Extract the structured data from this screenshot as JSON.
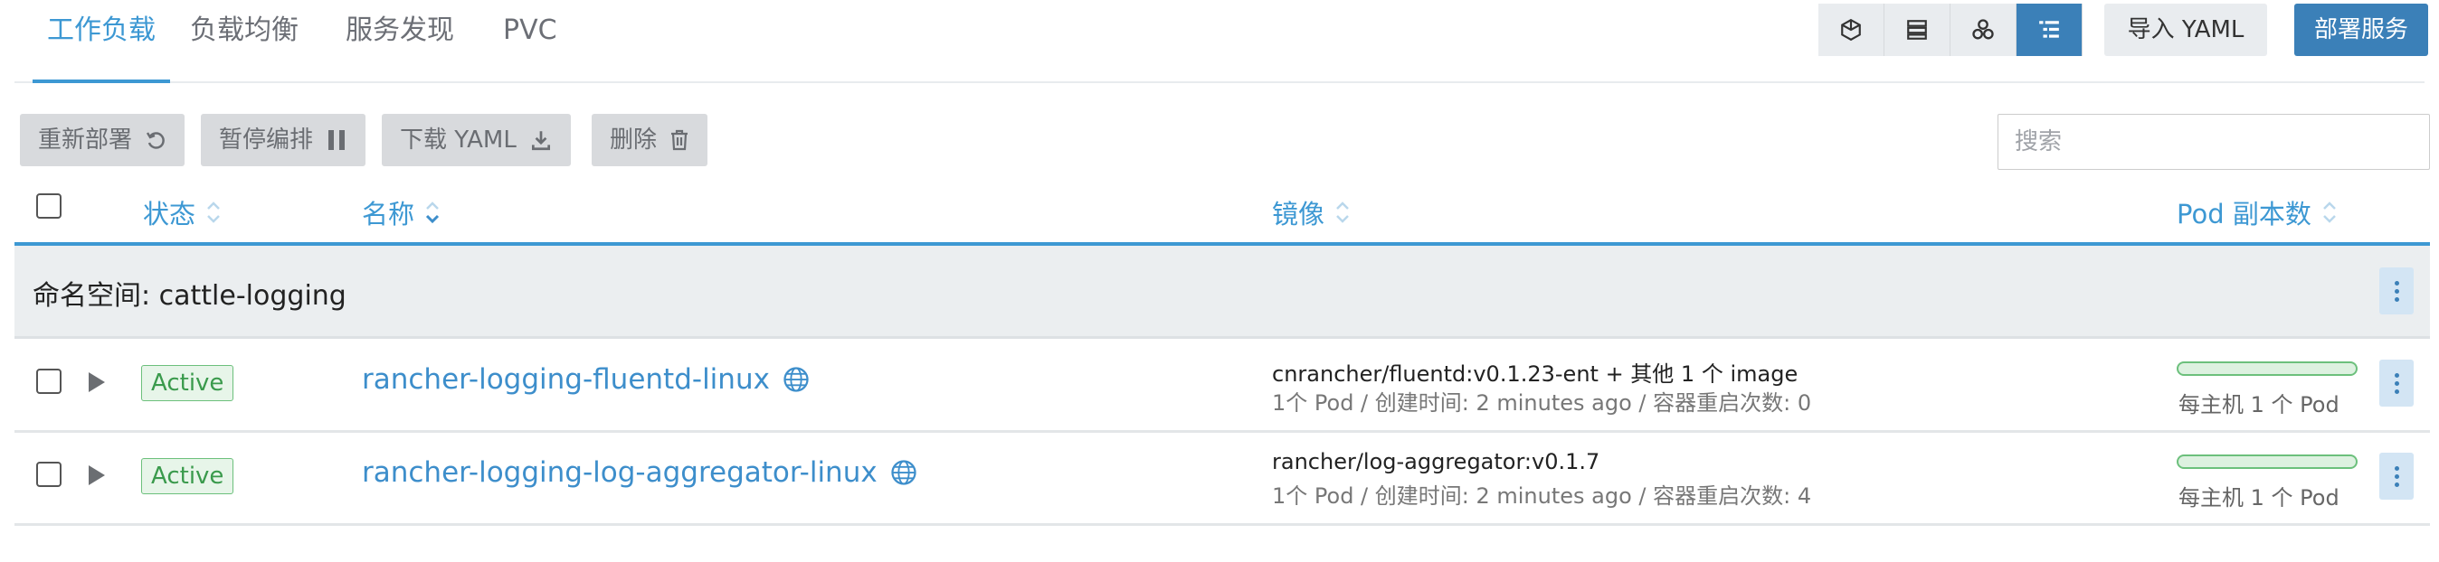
{
  "tabs": [
    {
      "label": "工作负载",
      "active": true
    },
    {
      "label": "负载均衡",
      "active": false
    },
    {
      "label": "服务发现",
      "active": false
    },
    {
      "label": "PVC",
      "active": false
    }
  ],
  "view_buttons": [
    {
      "icon": "cube-icon",
      "active": false
    },
    {
      "icon": "server-stack-icon",
      "active": false
    },
    {
      "icon": "cluster-icon",
      "active": false
    },
    {
      "icon": "list-tree-icon",
      "active": true
    }
  ],
  "header_actions": {
    "import_label": "导入 YAML",
    "deploy_label": "部署服务"
  },
  "actions": {
    "redeploy": "重新部署",
    "pause": "暂停编排",
    "download": "下载 YAML",
    "delete": "删除"
  },
  "search": {
    "placeholder": "搜索",
    "value": ""
  },
  "columns": {
    "state": "状态",
    "name": "名称",
    "image": "镜像",
    "pods": "Pod 副本数"
  },
  "namespace": {
    "label": "命名空间: cattle-logging"
  },
  "rows": [
    {
      "state": "Active",
      "name": "rancher-logging-fluentd-linux",
      "image": "cnrancher/fluentd:v0.1.23-ent + 其他 1 个 image",
      "meta": "1个 Pod / 创建时间: 2 minutes ago / 容器重启次数: 0",
      "pods": "每主机 1 个 Pod"
    },
    {
      "state": "Active",
      "name": "rancher-logging-log-aggregator-linux",
      "image": "rancher/log-aggregator:v0.1.7",
      "meta": "1个 Pod / 创建时间: 2 minutes ago / 容器重启次数: 4",
      "pods": "每主机 1 个 Pod"
    }
  ],
  "colors": {
    "accent": "#3d98d3",
    "primary_button": "#3b80b8",
    "active_badge": "#3a9a4c"
  }
}
